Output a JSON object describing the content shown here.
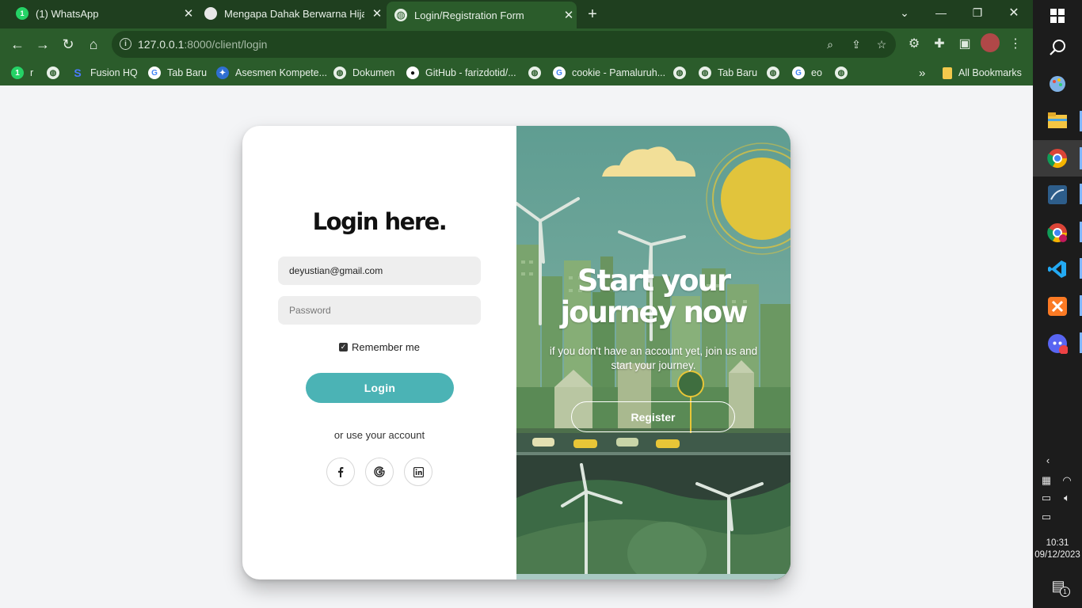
{
  "browser": {
    "tabs": [
      {
        "title": "(1) WhatsApp",
        "icon": "whatsapp-icon",
        "active": false
      },
      {
        "title": "Mengapa Dahak Berwarna Hijau",
        "icon": "page-icon",
        "active": false
      },
      {
        "title": "Login/Registration Form",
        "icon": "globe-icon",
        "active": true
      }
    ],
    "new_tab_label": "+",
    "url_host": "127.0.0.1",
    "url_path": ":8000/client/login",
    "bookmarks": [
      {
        "label": "r",
        "icon": "whatsapp-icon"
      },
      {
        "label": "",
        "icon": "globe-icon"
      },
      {
        "label": "Fusion HQ",
        "icon": "fusion-icon"
      },
      {
        "label": "Tab Baru",
        "icon": "google-icon"
      },
      {
        "label": "Asesmen Kompete...",
        "icon": "kemdikbud-icon"
      },
      {
        "label": "Dokumen",
        "icon": "globe-icon"
      },
      {
        "label": "GitHub - farizdotid/...",
        "icon": "github-icon"
      },
      {
        "label": "",
        "icon": "globe-icon"
      },
      {
        "label": "cookie - Pamaluruh...",
        "icon": "google-icon"
      },
      {
        "label": "",
        "icon": "globe-icon"
      },
      {
        "label": "Tab Baru",
        "icon": "globe-icon"
      },
      {
        "label": "",
        "icon": "globe-icon"
      },
      {
        "label": "eo",
        "icon": "google-icon"
      },
      {
        "label": "",
        "icon": "globe-icon"
      }
    ],
    "more_bookmarks": "»",
    "all_bookmarks": "All Bookmarks"
  },
  "login": {
    "title": "Login here.",
    "email_value": "deyustian@gmail.com",
    "password_placeholder": "Password",
    "remember_label": "Remember me",
    "remember_checked": true,
    "login_button": "Login",
    "or_text": "or use your account"
  },
  "register_panel": {
    "title": "Start your journey now",
    "subtitle": "if you don't have an account yet, join us and start your journey.",
    "register_button": "Register"
  },
  "taskbar": {
    "time": "10:31",
    "date": "09/12/2023",
    "notification_count": "1",
    "discord_badge": "9+"
  },
  "colors": {
    "browser_frame": "#2b5c2b",
    "accent": "#4bb3b5",
    "page_bg": "#f3f4f6"
  }
}
